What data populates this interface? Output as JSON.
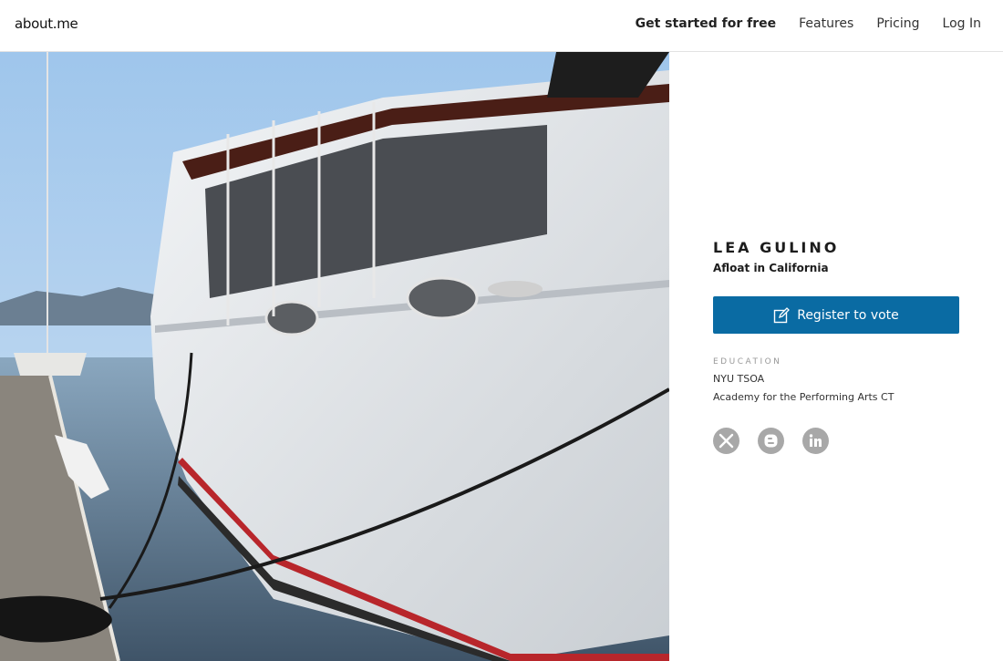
{
  "header": {
    "logo": "about.me",
    "nav": {
      "get_started": "Get started for free",
      "features": "Features",
      "pricing": "Pricing",
      "login": "Log In"
    }
  },
  "profile": {
    "name": "LEA GULINO",
    "headline": "Afloat in California",
    "cta_label": "Register to vote",
    "education_label": "EDUCATION",
    "education": [
      "NYU TSOA",
      "Academy for the Performing Arts CT"
    ],
    "socials": [
      "x-icon",
      "blogger-icon",
      "linkedin-icon"
    ]
  },
  "colors": {
    "cta": "#0a6ba3",
    "social": "#a8a8a8"
  }
}
